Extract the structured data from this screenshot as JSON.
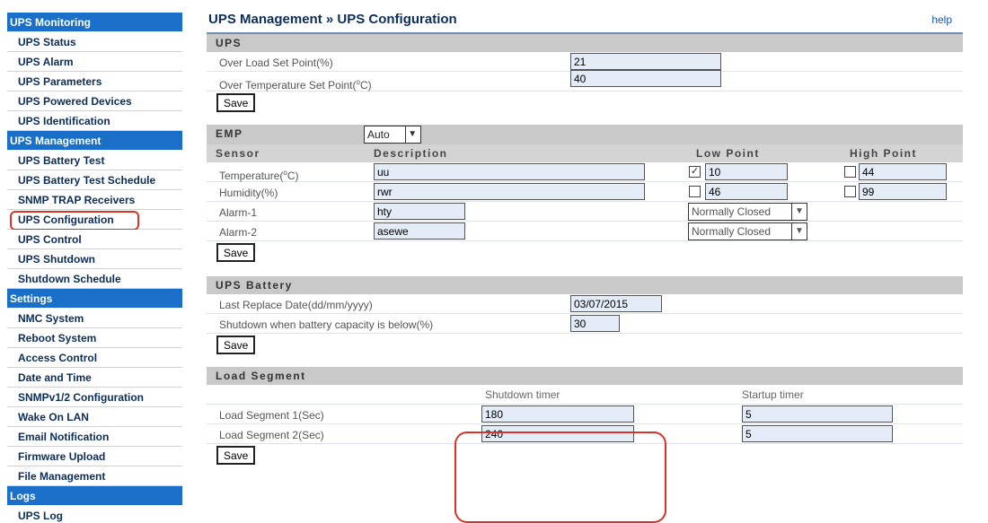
{
  "sidebar": {
    "groups": [
      {
        "label": "UPS Monitoring",
        "items": [
          "UPS Status",
          "UPS Alarm",
          "UPS Parameters",
          "UPS Powered Devices",
          "UPS Identification"
        ]
      },
      {
        "label": "UPS Management",
        "items": [
          "UPS Battery Test",
          "UPS Battery Test Schedule",
          "SNMP TRAP Receivers",
          "UPS Configuration",
          "UPS Control",
          "UPS Shutdown",
          "Shutdown Schedule"
        ]
      },
      {
        "label": "Settings",
        "items": [
          "NMC System",
          "Reboot System",
          "Access Control",
          "Date and Time",
          "SNMPv1/2 Configuration",
          "Wake On LAN",
          "Email Notification",
          "Firmware Upload",
          "File Management"
        ]
      },
      {
        "label": "Logs",
        "items": [
          "UPS Log"
        ]
      }
    ]
  },
  "page": {
    "title": "UPS Management » UPS Configuration",
    "help": "help"
  },
  "ups": {
    "heading": "UPS",
    "overload_label": "Over Load Set Point(%)",
    "overload_value": "21",
    "overtemp_label": "Over Temperature Set Point(",
    "overtemp_label_unit": "C)",
    "overtemp_value": "40",
    "save": "Save"
  },
  "emp": {
    "heading": "EMP",
    "mode": "Auto",
    "col_sensor": "Sensor",
    "col_description": "Description",
    "col_low": "Low Point",
    "col_high": "High Point",
    "temp_label": "Temperature(",
    "temp_label_unit": "C)",
    "temp_desc": "uu",
    "temp_low_checked": "☑",
    "temp_low": "10",
    "temp_high": "44",
    "hum_label": "Humidity(%)",
    "hum_desc": "rwr",
    "hum_low": "46",
    "hum_high": "99",
    "alarm1_label": "Alarm-1",
    "alarm1_desc": "hty",
    "alarm1_state": "Normally Closed",
    "alarm2_label": "Alarm-2",
    "alarm2_desc": "asewe",
    "alarm2_state": "Normally Closed",
    "save": "Save"
  },
  "battery": {
    "heading": "UPS Battery",
    "replace_label": "Last Replace Date(dd/mm/yyyy)",
    "replace_value": "03/07/2015",
    "shutdown_label": "Shutdown when battery capacity is below(%)",
    "shutdown_value": "30",
    "save": "Save"
  },
  "load": {
    "heading": "Load Segment",
    "col_shutdown": "Shutdown timer",
    "col_startup": "Startup timer",
    "seg1_label": "Load Segment 1(Sec)",
    "seg1_shutdown": "180",
    "seg1_startup": "5",
    "seg2_label": "Load Segment 2(Sec)",
    "seg2_shutdown": "240",
    "seg2_startup": "5",
    "save": "Save"
  },
  "colors": {
    "nav_group": "#1a6fc9",
    "section_head": "#c9c9c9",
    "input_bg": "#e3ecf7",
    "highlight": "#d9342b"
  }
}
